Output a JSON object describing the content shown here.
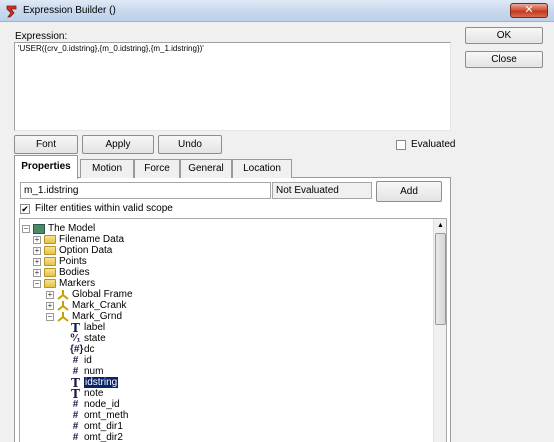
{
  "window": {
    "title": "Expression Builder ()",
    "close_glyph": "✕"
  },
  "expression": {
    "label": "Expression:",
    "value": "'USER({crv_0.idstring},{m_0.idstring},{m_1.idstring})'"
  },
  "buttons": {
    "ok": "OK",
    "close": "Close",
    "font": "Font",
    "apply": "Apply",
    "undo": "Undo",
    "add": "Add"
  },
  "evaluated": {
    "label": "Evaluated",
    "checked": false
  },
  "tabs": [
    "Properties",
    "Motion",
    "Force",
    "General",
    "Location"
  ],
  "active_tab": "Properties",
  "properties": {
    "name_value": "m_1.idstring",
    "eval_value": "Not Evaluated",
    "filter_label": "Filter entities within valid scope",
    "filter_checked": true,
    "filter_glyph": "✔"
  },
  "tree": {
    "root": "The Model",
    "folders": [
      "Filename Data",
      "Option Data",
      "Points",
      "Bodies",
      "Markers"
    ],
    "markers": [
      "Global Frame",
      "Mark_Crank",
      "Mark_Grnd"
    ],
    "attributes": [
      {
        "icon": "T",
        "label": "label"
      },
      {
        "icon": "⁰⁄₁",
        "label": "state"
      },
      {
        "icon": "{#}",
        "label": "dc"
      },
      {
        "icon": "#",
        "label": "id"
      },
      {
        "icon": "#",
        "label": "num"
      },
      {
        "icon": "T",
        "label": "idstring"
      },
      {
        "icon": "T",
        "label": "note"
      },
      {
        "icon": "#",
        "label": "node_id"
      },
      {
        "icon": "#",
        "label": "omt_meth"
      },
      {
        "icon": "#",
        "label": "omt_dir1"
      },
      {
        "icon": "#",
        "label": "omt_dir2"
      }
    ],
    "selected": "idstring",
    "expand_plus": "+",
    "expand_minus": "−"
  },
  "scroll_up_glyph": "▲",
  "colors": {
    "selection": "#0a246a",
    "titlebar": "#c9d9ee",
    "close_button": "#c23a1e",
    "model_icon": "#4a8a6a",
    "folder": "#e6c347"
  }
}
